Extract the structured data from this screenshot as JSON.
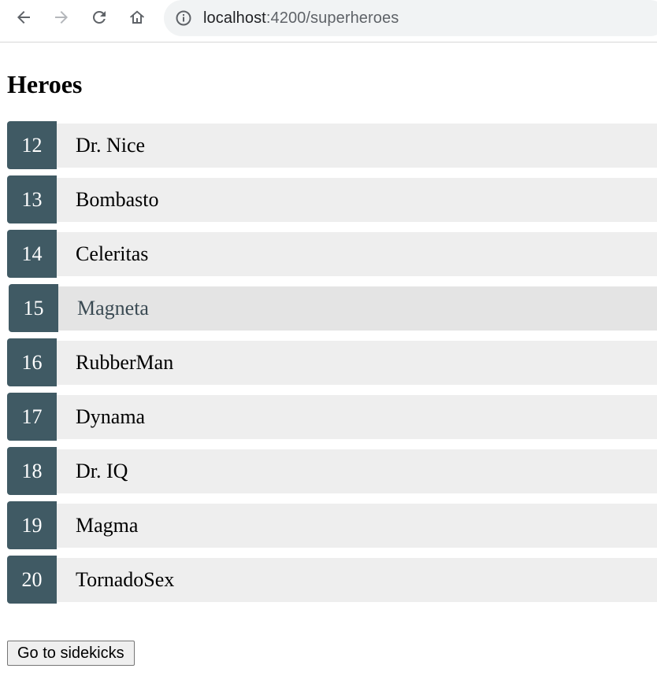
{
  "browser": {
    "url_host": "localhost",
    "url_path": ":4200/superheroes"
  },
  "page": {
    "title": "Heroes"
  },
  "heroes": [
    {
      "id": "12",
      "name": "Dr. Nice"
    },
    {
      "id": "13",
      "name": "Bombasto"
    },
    {
      "id": "14",
      "name": "Celeritas"
    },
    {
      "id": "15",
      "name": "Magneta"
    },
    {
      "id": "16",
      "name": "RubberMan"
    },
    {
      "id": "17",
      "name": "Dynama"
    },
    {
      "id": "18",
      "name": "Dr. IQ"
    },
    {
      "id": "19",
      "name": "Magma"
    },
    {
      "id": "20",
      "name": "TornadoSex"
    }
  ],
  "actions": {
    "go_to_sidekicks": "Go to sidekicks"
  },
  "colors": {
    "badge_bg": "#405a64",
    "row_bg": "#eeeeee",
    "row_hover_bg": "#e4e4e4"
  },
  "state": {
    "hovered_hero_id": "15"
  }
}
